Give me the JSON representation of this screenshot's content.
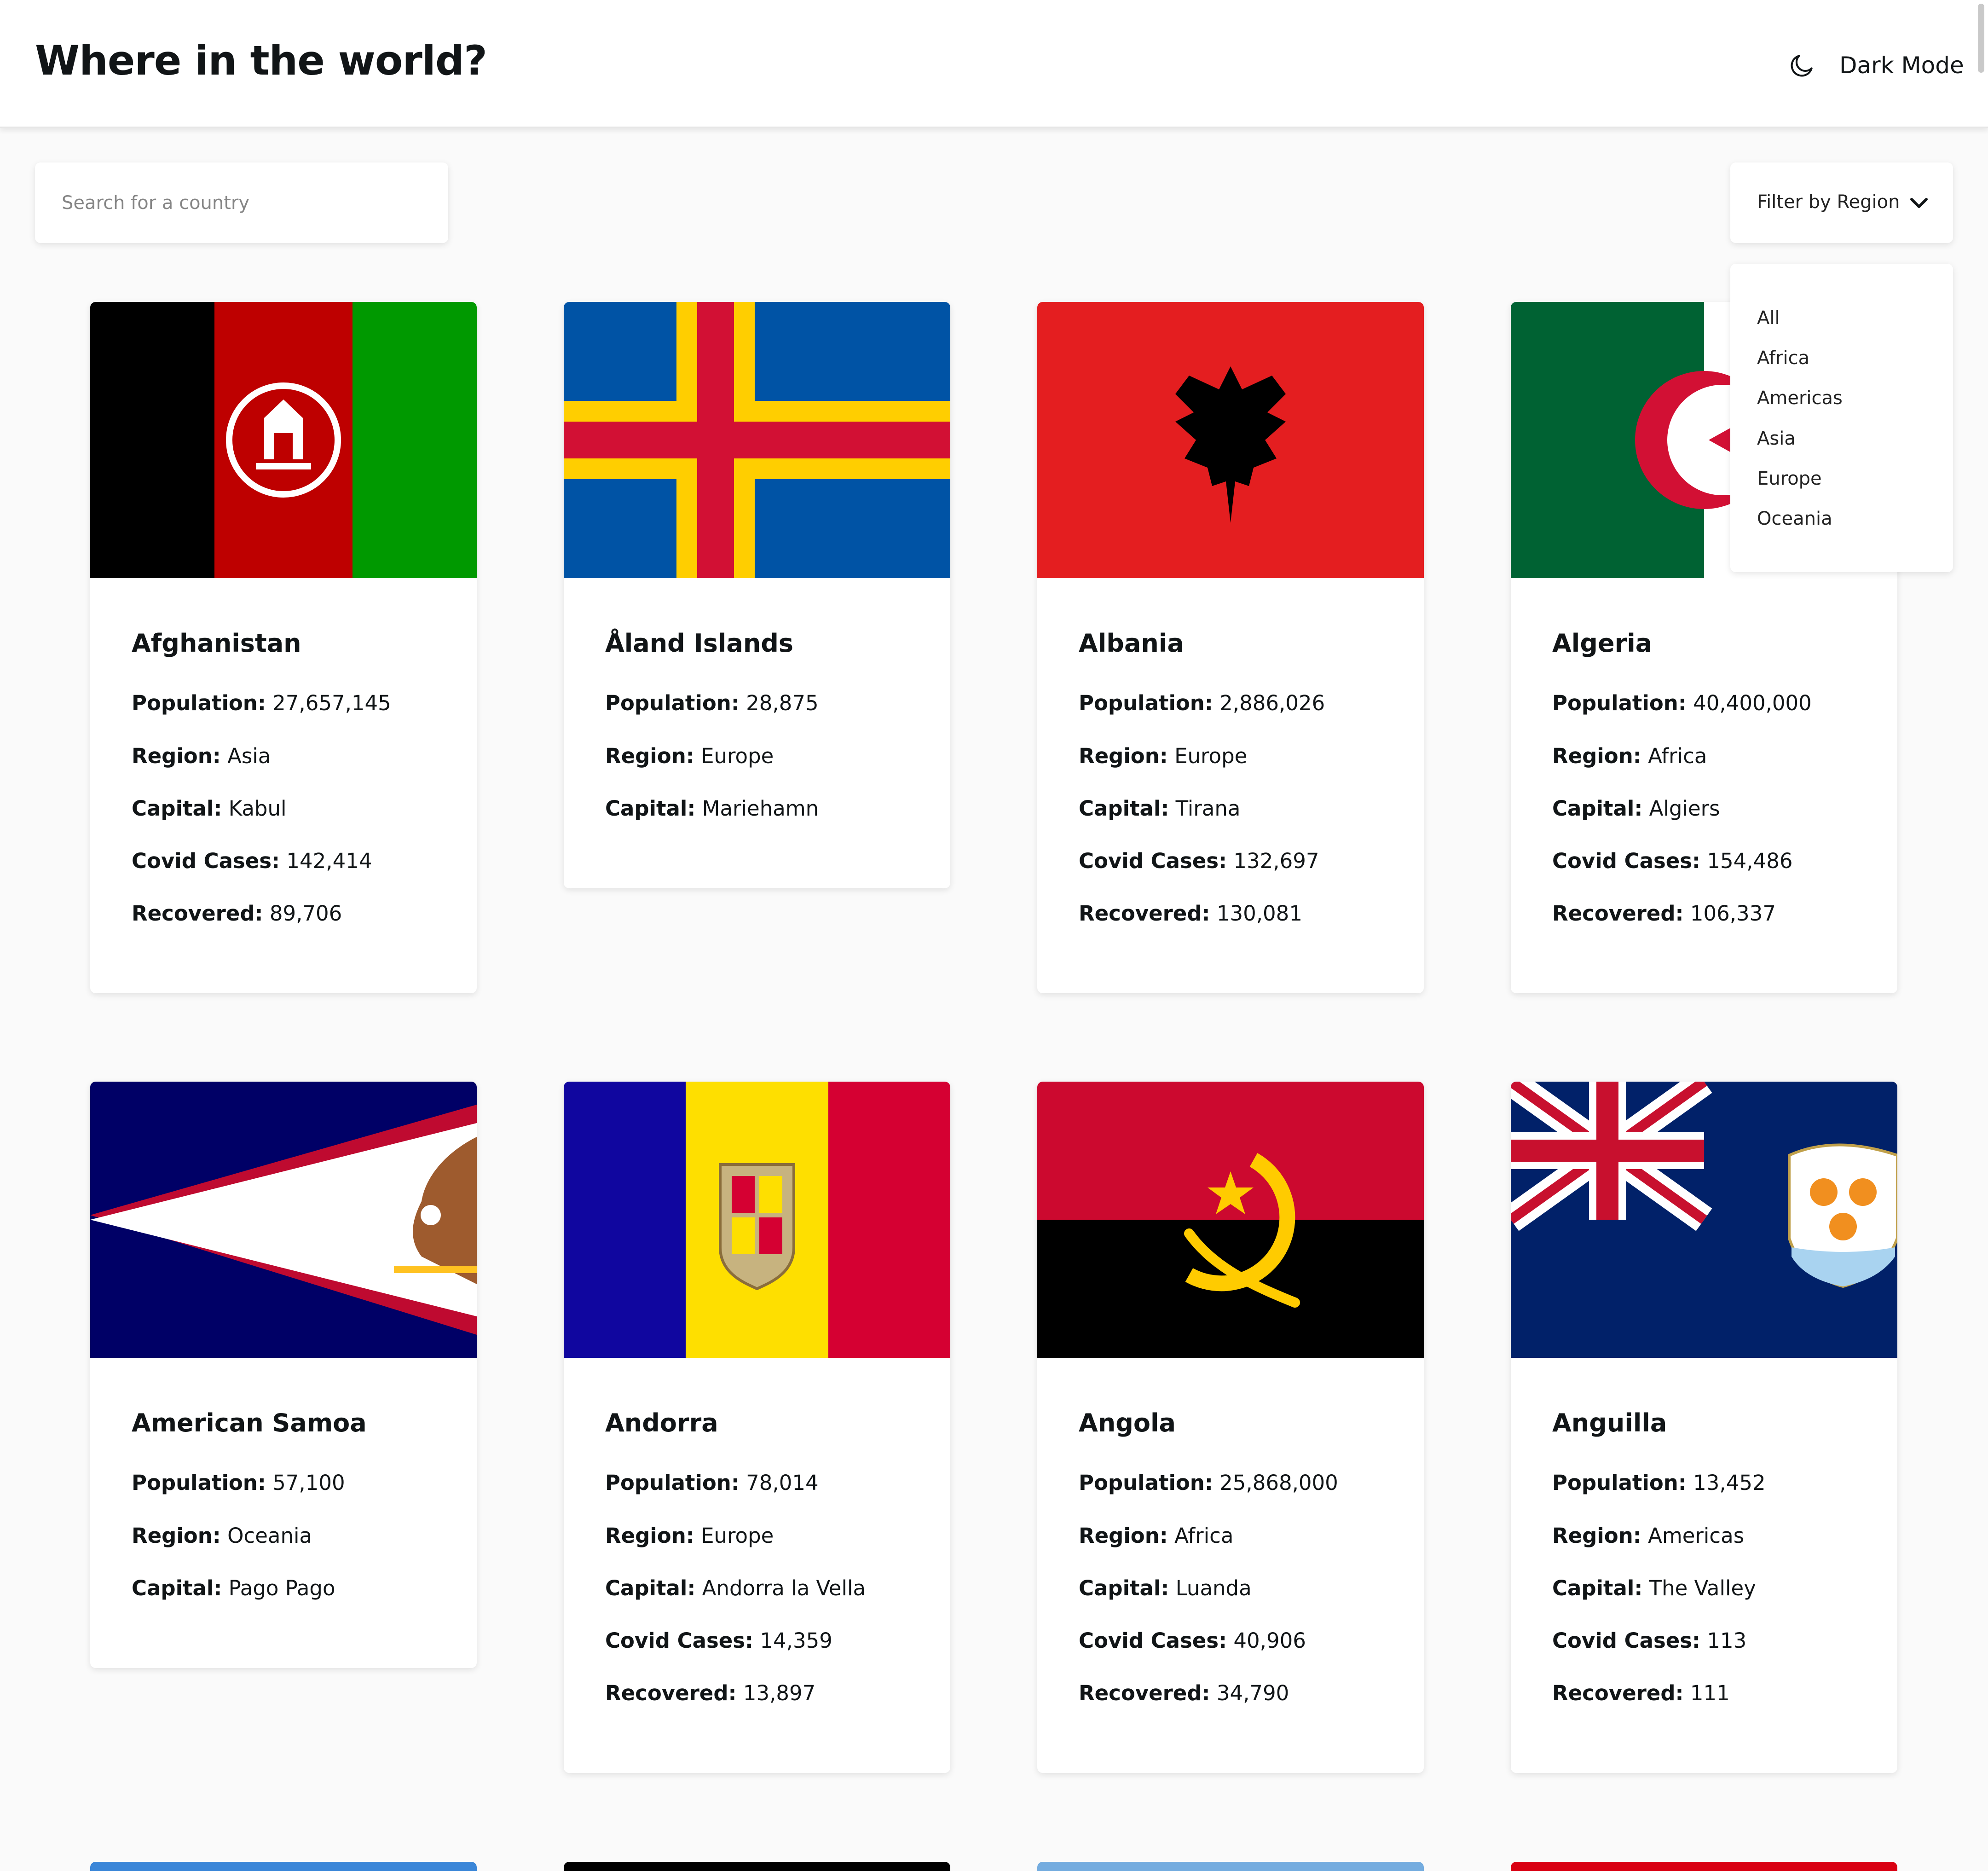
{
  "header": {
    "title": "Where in the world?",
    "mode_toggle_label": "Dark Mode"
  },
  "search": {
    "placeholder": "Search for a country",
    "value": ""
  },
  "filter": {
    "label": "Filter by Region",
    "options": [
      "All",
      "Africa",
      "Americas",
      "Asia",
      "Europe",
      "Oceania"
    ]
  },
  "labels": {
    "population": "Population:",
    "region": "Region:",
    "capital": "Capital:",
    "covid": "Covid Cases:",
    "recovered": "Recovered:"
  },
  "countries": [
    {
      "name": "Afghanistan",
      "population": "27,657,145",
      "region": "Asia",
      "capital": "Kabul",
      "covid_cases": "142,414",
      "recovered": "89,706",
      "flag_icon": "afghanistan-flag-icon"
    },
    {
      "name": "Åland Islands",
      "population": "28,875",
      "region": "Europe",
      "capital": "Mariehamn",
      "flag_icon": "aland-islands-flag-icon"
    },
    {
      "name": "Albania",
      "population": "2,886,026",
      "region": "Europe",
      "capital": "Tirana",
      "covid_cases": "132,697",
      "recovered": "130,081",
      "flag_icon": "albania-flag-icon"
    },
    {
      "name": "Algeria",
      "population": "40,400,000",
      "region": "Africa",
      "capital": "Algiers",
      "covid_cases": "154,486",
      "recovered": "106,337",
      "flag_icon": "algeria-flag-icon"
    },
    {
      "name": "American Samoa",
      "population": "57,100",
      "region": "Oceania",
      "capital": "Pago Pago",
      "flag_icon": "american-samoa-flag-icon"
    },
    {
      "name": "Andorra",
      "population": "78,014",
      "region": "Europe",
      "capital": "Andorra la Vella",
      "covid_cases": "14,359",
      "recovered": "13,897",
      "flag_icon": "andorra-flag-icon"
    },
    {
      "name": "Angola",
      "population": "25,868,000",
      "region": "Africa",
      "capital": "Luanda",
      "covid_cases": "40,906",
      "recovered": "34,790",
      "flag_icon": "angola-flag-icon"
    },
    {
      "name": "Anguilla",
      "population": "13,452",
      "region": "Americas",
      "capital": "The Valley",
      "covid_cases": "113",
      "recovered": "111",
      "flag_icon": "anguilla-flag-icon"
    }
  ],
  "colors": {
    "background": "#fafafa",
    "card": "#ffffff",
    "text": "#111517",
    "placeholder": "#858585"
  }
}
